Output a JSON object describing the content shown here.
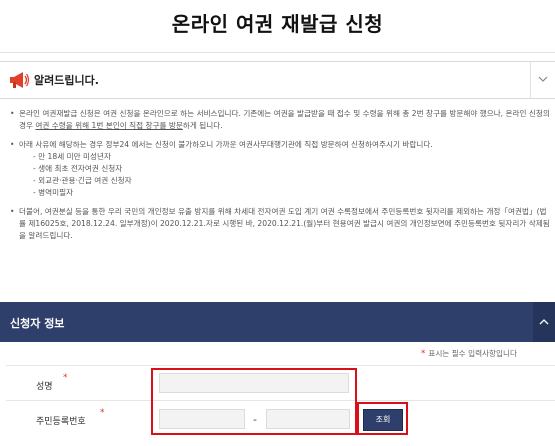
{
  "page": {
    "title": "온라인 여권 재발급 신청"
  },
  "notice": {
    "title": "알려드립니다.",
    "paragraphs": {
      "p1_a": "온라인 여권재발급 신청은 여권 신청을 온라인으로 하는 서비스입니다. 기존에는 여권을 발급받을 때 접수 및 수령을 위해 총 2번 창구를 방문해야 했으나, 온라인 신청의 경우 ",
      "p1_u": "여권 수령을 위해 1번 본인이 직접 창구를 방문",
      "p1_b": "하게 됩니다.",
      "p2": "아래 사유에 해당하는 경우 정부24 에서는 신청이 불가하오니 가까운 여권사무대행기관에 직접 방문하여 신청하여주시기 바랍니다.",
      "p2_items": [
        "- 만 18세 미만 미성년자",
        "- 생애 최초 전자여권 신청자",
        "- 외교관·관용·긴급 여권 신청자",
        "- 병역미필자"
      ],
      "p3": "더불어, 여권분실 등을 통한 우리 국민의 개인정보 유출 방지를 위해 차세대 전자여권 도입 계기 여권 수록정보에서 주민등록번호 뒷자리를 제외하는 개정「여권법」(법률 제16025호, 2018.12.24. 일부개정)이 2020.12.21.자로 시행된 바, 2020.12.21.(월)부터 현용여권 발급시 여권의 개인정보면에 주민등록번호 뒷자리가 삭제됨을 알려드립니다."
    }
  },
  "applicant": {
    "section_title": "신청자 정보",
    "required_note": "표시는 필수 입력사항입니다",
    "name_label": "성명",
    "name_value": "",
    "rrn_label": "주민등록번호",
    "rrn_front": "",
    "rrn_back": "",
    "dash": "-",
    "lookup_button": "조회"
  },
  "colors": {
    "section_bar": "#2e3f6b",
    "highlight": "#d9101a",
    "required": "#e03131"
  }
}
